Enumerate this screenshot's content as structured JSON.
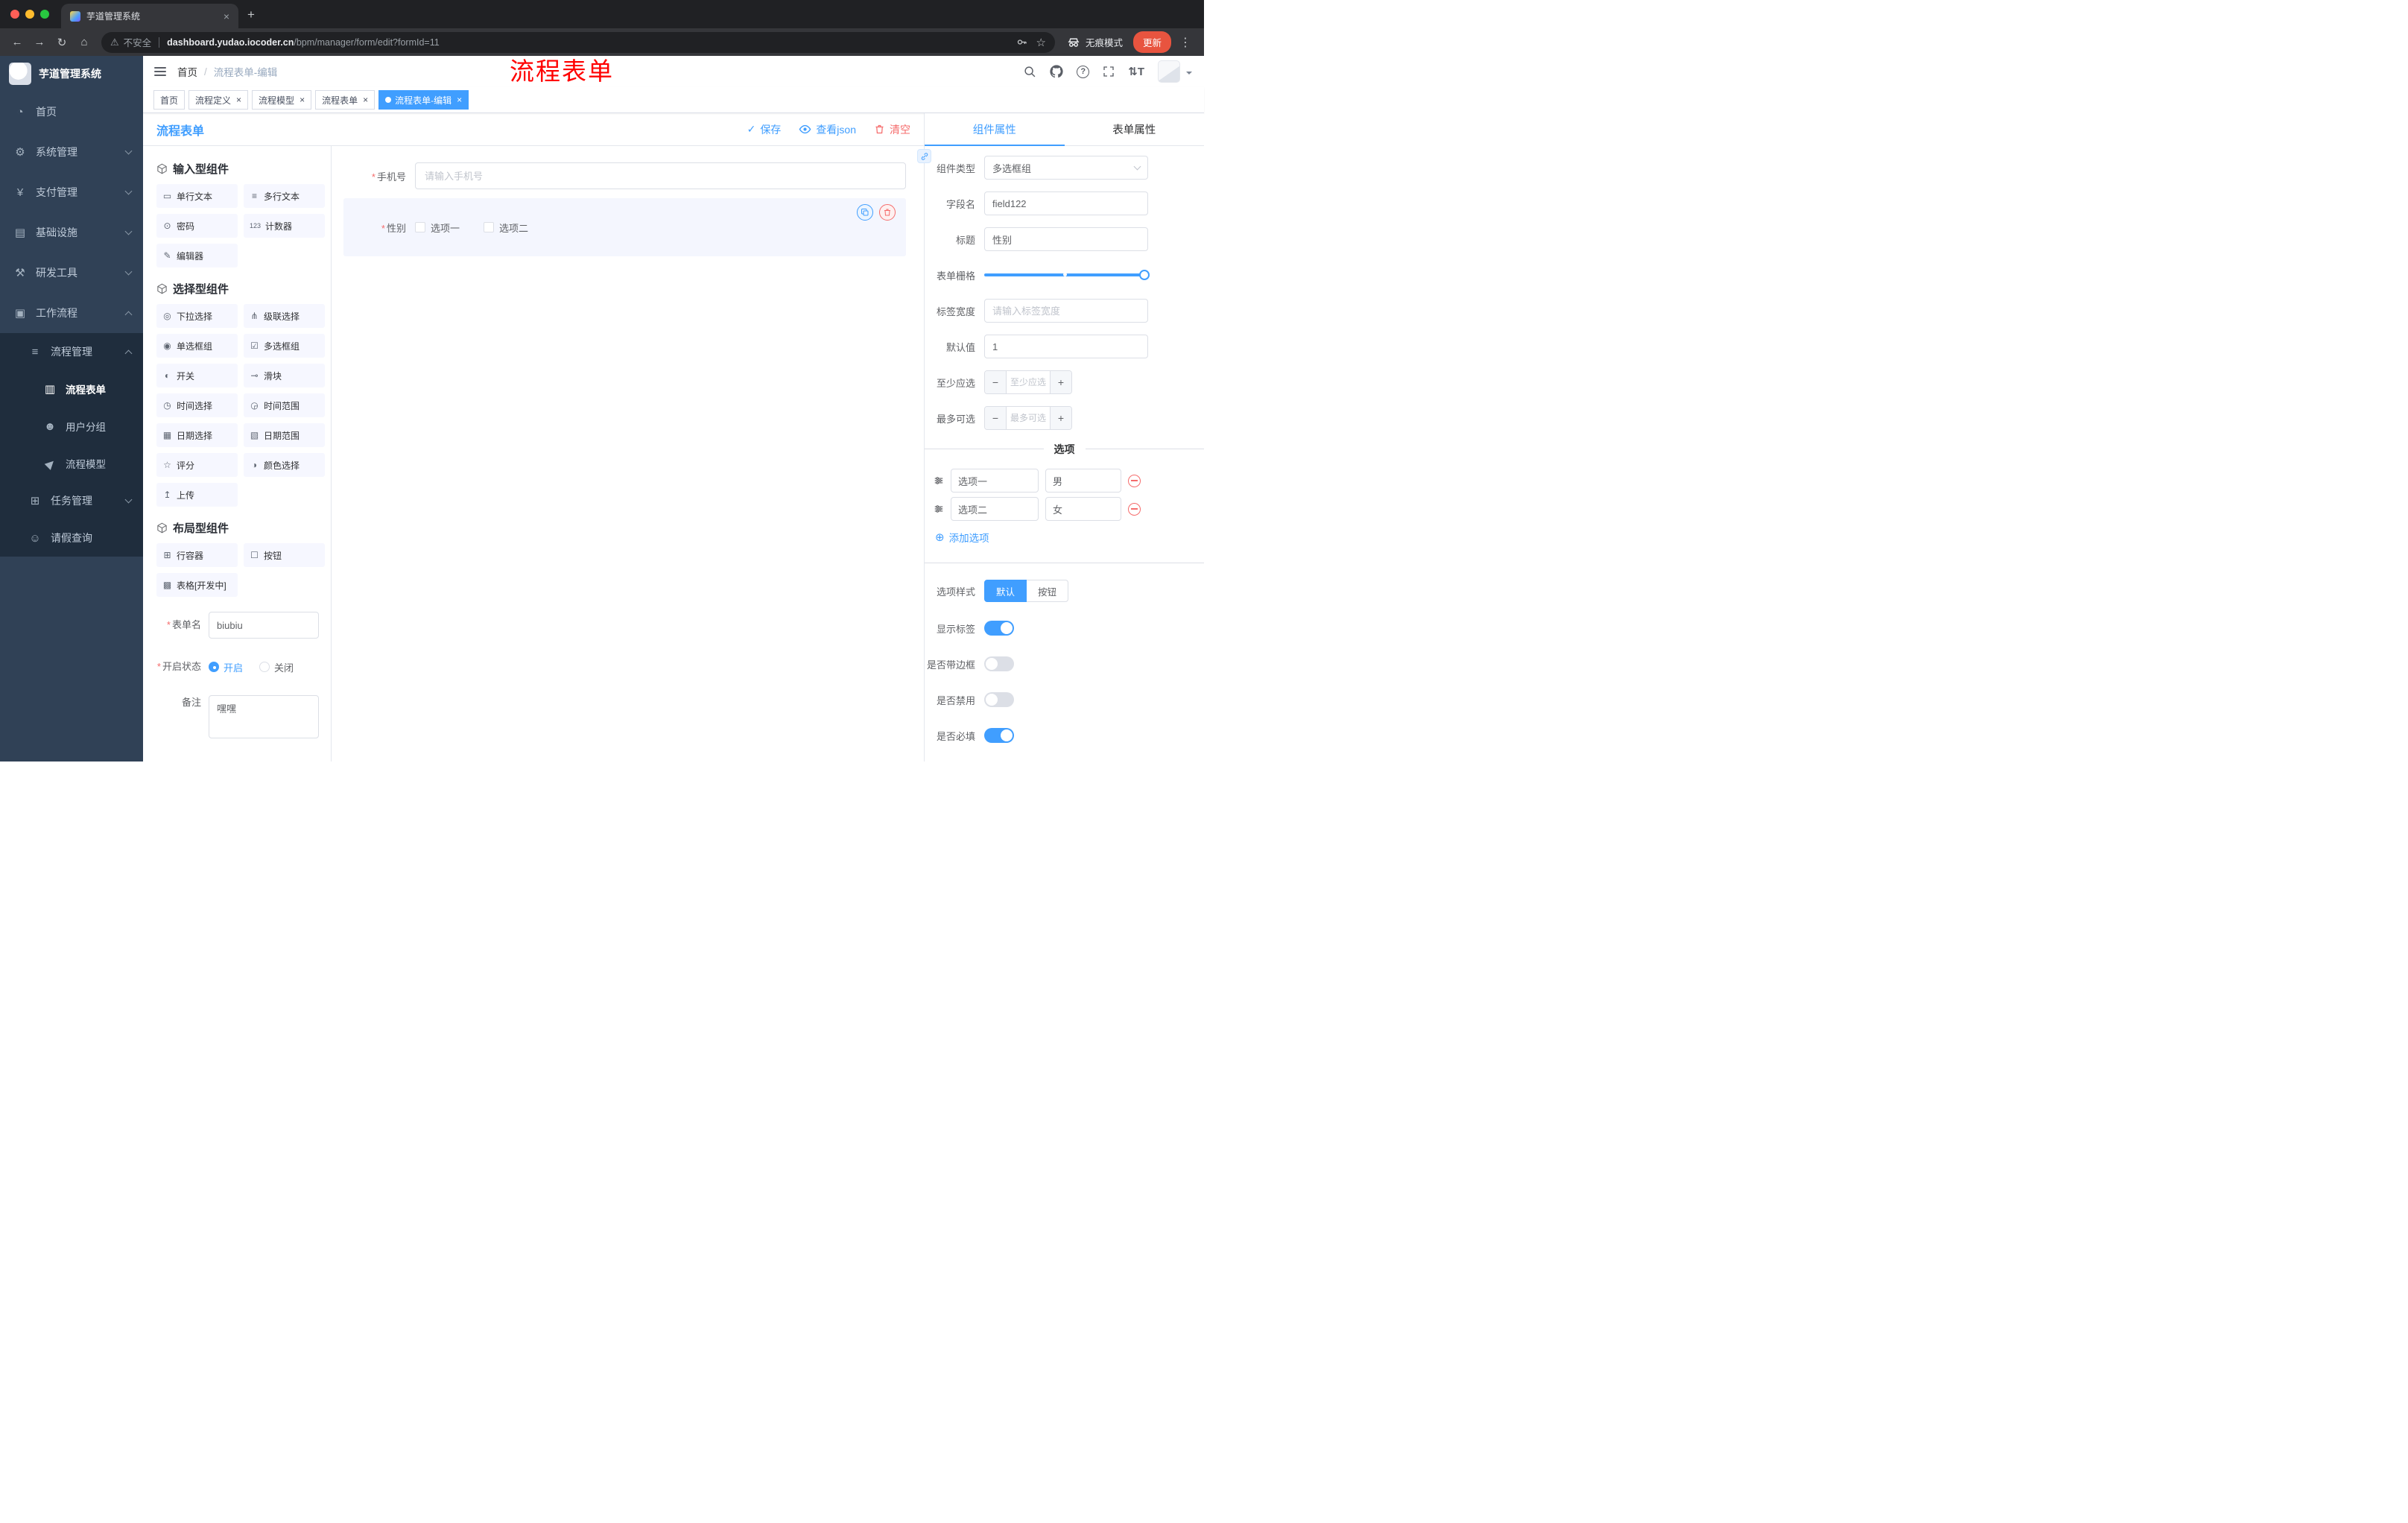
{
  "misc": {
    "required_mark": "*",
    "close": "×",
    "breadcrumb_sep": "/"
  },
  "colors": {
    "accent": "#409EFF",
    "danger": "#F56C6C",
    "annotation_red": "#FF0000",
    "sidebar_bg": "#304156",
    "sidebar_submenu_bg": "#1F2D3D",
    "tag_active_bg": "#409EFF",
    "update_button_bg": "#E8543F",
    "widget_selected_bg": "#F4F6FE"
  },
  "icons": {
    "back": "←",
    "forward": "→",
    "reload": "↻",
    "home": "⌂",
    "warning": "⚠",
    "star": "☆",
    "dots": "⋮",
    "new_tab": "+",
    "help": "?",
    "font_size": "⇅T",
    "save_check": "✓",
    "minus": "−",
    "plus": "+",
    "add_circle": "⊕",
    "menu_dashboard": "◔",
    "menu_system": "⚙",
    "menu_payment": "¥",
    "menu_infra": "▤",
    "menu_devtools": "⚒",
    "menu_workflow": "▣",
    "menu_process": "≡",
    "menu_form": "▥",
    "menu_users": "☻",
    "menu_model": "▶",
    "menu_task": "⊞",
    "menu_person": "☺"
  },
  "browser": {
    "tab_title": "芋道管理系统",
    "security": "不安全",
    "url_host": "dashboard.yudao.iocoder.cn",
    "url_path": "/bpm/manager/form/edit?formId=11",
    "incognito": "无痕模式",
    "update": "更新"
  },
  "sidebar": {
    "title": "芋道管理系统",
    "menu": [
      {
        "label": "首页"
      },
      {
        "label": "系统管理"
      },
      {
        "label": "支付管理"
      },
      {
        "label": "基础设施"
      },
      {
        "label": "研发工具"
      },
      {
        "label": "工作流程"
      },
      {
        "label": "流程管理"
      },
      {
        "label": "流程表单"
      },
      {
        "label": "用户分组"
      },
      {
        "label": "流程模型"
      },
      {
        "label": "任务管理"
      },
      {
        "label": "请假查询"
      }
    ]
  },
  "header": {
    "breadcrumb_home": "首页",
    "breadcrumb_current": "流程表单-编辑",
    "annotation": "流程表单"
  },
  "tags": [
    {
      "label": "首页"
    },
    {
      "label": "流程定义"
    },
    {
      "label": "流程模型"
    },
    {
      "label": "流程表单"
    },
    {
      "label": "流程表单-编辑"
    }
  ],
  "designer": {
    "page_title": "流程表单",
    "actions": {
      "save": "保存",
      "view_json": "查看json",
      "clear": "清空"
    },
    "palette": {
      "sections": [
        {
          "title": "输入型组件",
          "items": [
            {
              "icon": "▭",
              "label": "单行文本"
            },
            {
              "icon": "≡",
              "label": "多行文本"
            },
            {
              "icon": "⊙",
              "label": "密码"
            },
            {
              "icon": "123",
              "label": "计数器"
            },
            {
              "icon": "✎",
              "label": "编辑器"
            }
          ]
        },
        {
          "title": "选择型组件",
          "items": [
            {
              "icon": "◎",
              "label": "下拉选择"
            },
            {
              "icon": "⋔",
              "label": "级联选择"
            },
            {
              "icon": "◉",
              "label": "单选框组"
            },
            {
              "icon": "☑",
              "label": "多选框组"
            },
            {
              "icon": "◐",
              "label": "开关"
            },
            {
              "icon": "⊸",
              "label": "滑块"
            },
            {
              "icon": "◷",
              "label": "时间选择"
            },
            {
              "icon": "◶",
              "label": "时间范围"
            },
            {
              "icon": "▦",
              "label": "日期选择"
            },
            {
              "icon": "▧",
              "label": "日期范围"
            },
            {
              "icon": "☆",
              "label": "评分"
            },
            {
              "icon": "◑",
              "label": "颜色选择"
            },
            {
              "icon": "↥",
              "label": "上传"
            }
          ]
        },
        {
          "title": "布局型组件",
          "items": [
            {
              "icon": "⊞",
              "label": "行容器"
            },
            {
              "icon": "☐",
              "label": "按钮"
            },
            {
              "icon": "▩",
              "label": "表格[开发中]"
            }
          ]
        }
      ]
    },
    "meta": {
      "form_name_label": "表单名",
      "form_name_value": "biubiu",
      "status_label": "开启状态",
      "status_on": "开启",
      "status_off": "关闭",
      "remark_label": "备注",
      "remark_value": "嘿嘿"
    },
    "canvas": {
      "phone": {
        "label": "手机号",
        "placeholder": "请输入手机号"
      },
      "gender": {
        "label": "性别",
        "option1": "选项一",
        "option2": "选项二"
      }
    },
    "props": {
      "tab_component": "组件属性",
      "tab_form": "表单属性",
      "component_type_label": "组件类型",
      "component_type_value": "多选框组",
      "field_name_label": "字段名",
      "field_name_value": "field122",
      "title_label": "标题",
      "title_value": "性别",
      "grid_label": "表单栅格",
      "label_width_label": "标签宽度",
      "label_width_placeholder": "请输入标签宽度",
      "default_label": "默认值",
      "default_value": "1",
      "min_label": "至少应选",
      "min_placeholder": "至少应选",
      "max_label": "最多可选",
      "max_placeholder": "最多可选",
      "options_title": "选项",
      "options": [
        {
          "label": "选项一",
          "value": "男"
        },
        {
          "label": "选项二",
          "value": "女"
        }
      ],
      "add_option": "添加选项",
      "style_label": "选项样式",
      "style_default": "默认",
      "style_button": "按钮",
      "show_label": "显示标签",
      "border_label": "是否带边框",
      "disabled_label": "是否禁用",
      "required_label": "是否必填"
    }
  }
}
